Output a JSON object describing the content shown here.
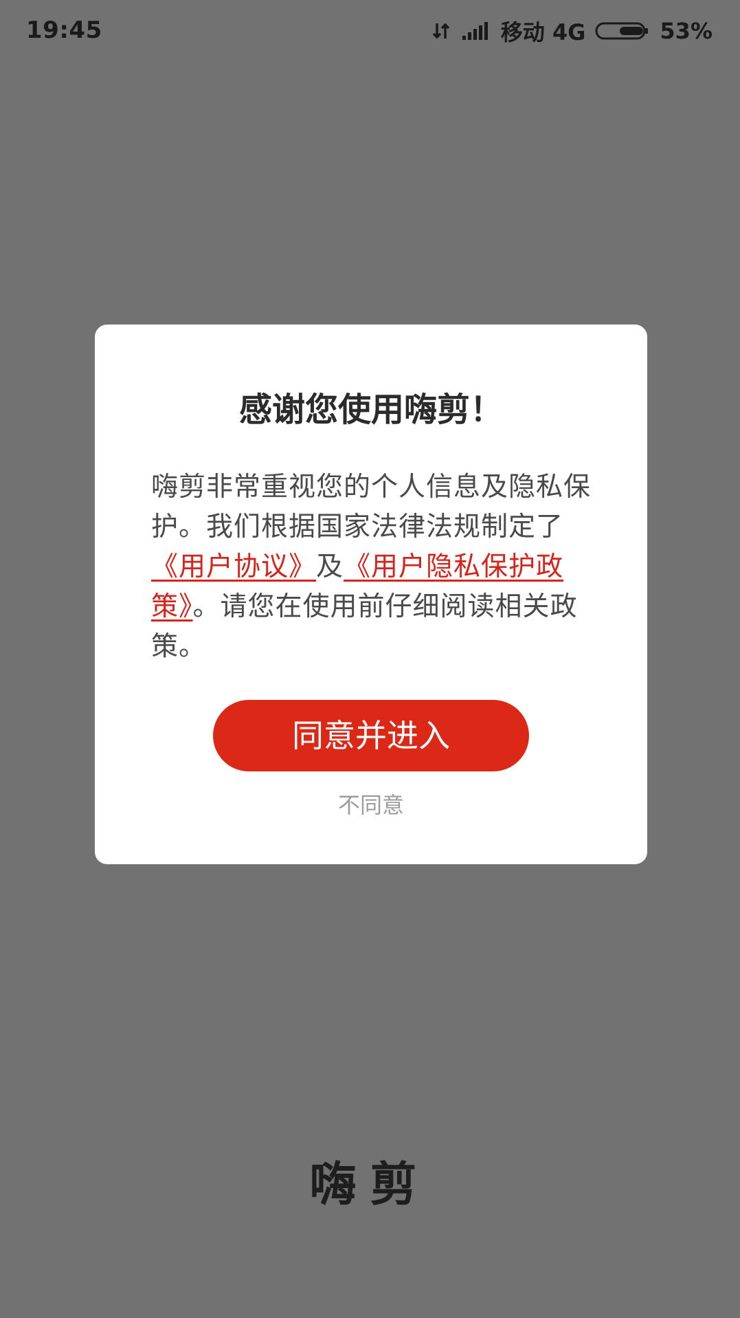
{
  "status_bar": {
    "time": "19:45",
    "carrier": "移动 4G",
    "battery_percent": "53%",
    "battery_level": 0.53,
    "icons": [
      "data-transfer-icon",
      "signal-icon",
      "battery-icon"
    ]
  },
  "dialog": {
    "title": "感谢您使用嗨剪！",
    "body": {
      "text_before": "嗨剪非常重视您的个人信息及隐私保护。我们根据国家法律法规制定了",
      "link_user_agreement": "《用户协议》",
      "text_middle": "及",
      "link_privacy_policy": "《用户隐私保护政策》",
      "text_after": "。请您在使用前仔细阅读相关政策。"
    },
    "agree_label": "同意并进入",
    "disagree_label": "不同意"
  },
  "splash": {
    "app_name": "嗨剪"
  },
  "colors": {
    "overlay_background": "#727272",
    "accent_red": "#dc2816",
    "link_red": "#d6231b",
    "dialog_background": "#ffffff"
  }
}
